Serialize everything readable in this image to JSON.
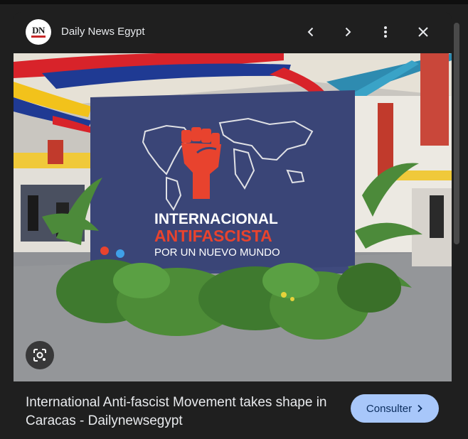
{
  "header": {
    "logo_text": "DN",
    "site_name": "Daily News Egypt",
    "icons": [
      "chevron-left-icon",
      "chevron-right-icon",
      "more-vert-icon",
      "close-icon"
    ]
  },
  "image": {
    "screen_line1": "INTERNACIONAL",
    "screen_line2": "ANTIFASCISTA",
    "screen_line3": "POR UN NUEVO MUNDO",
    "lens_icon": "lens-icon"
  },
  "caption": {
    "title": "International Anti-fascist Movement takes shape in Caracas - Dailynewsegypt"
  },
  "actions": {
    "visit_label": "Consulter"
  },
  "colors": {
    "background": "#1f1f1f",
    "button_bg": "#a8c7fa",
    "button_text": "#0b2d5e",
    "text": "#e8eaed",
    "screen_red": "#e8432e"
  }
}
